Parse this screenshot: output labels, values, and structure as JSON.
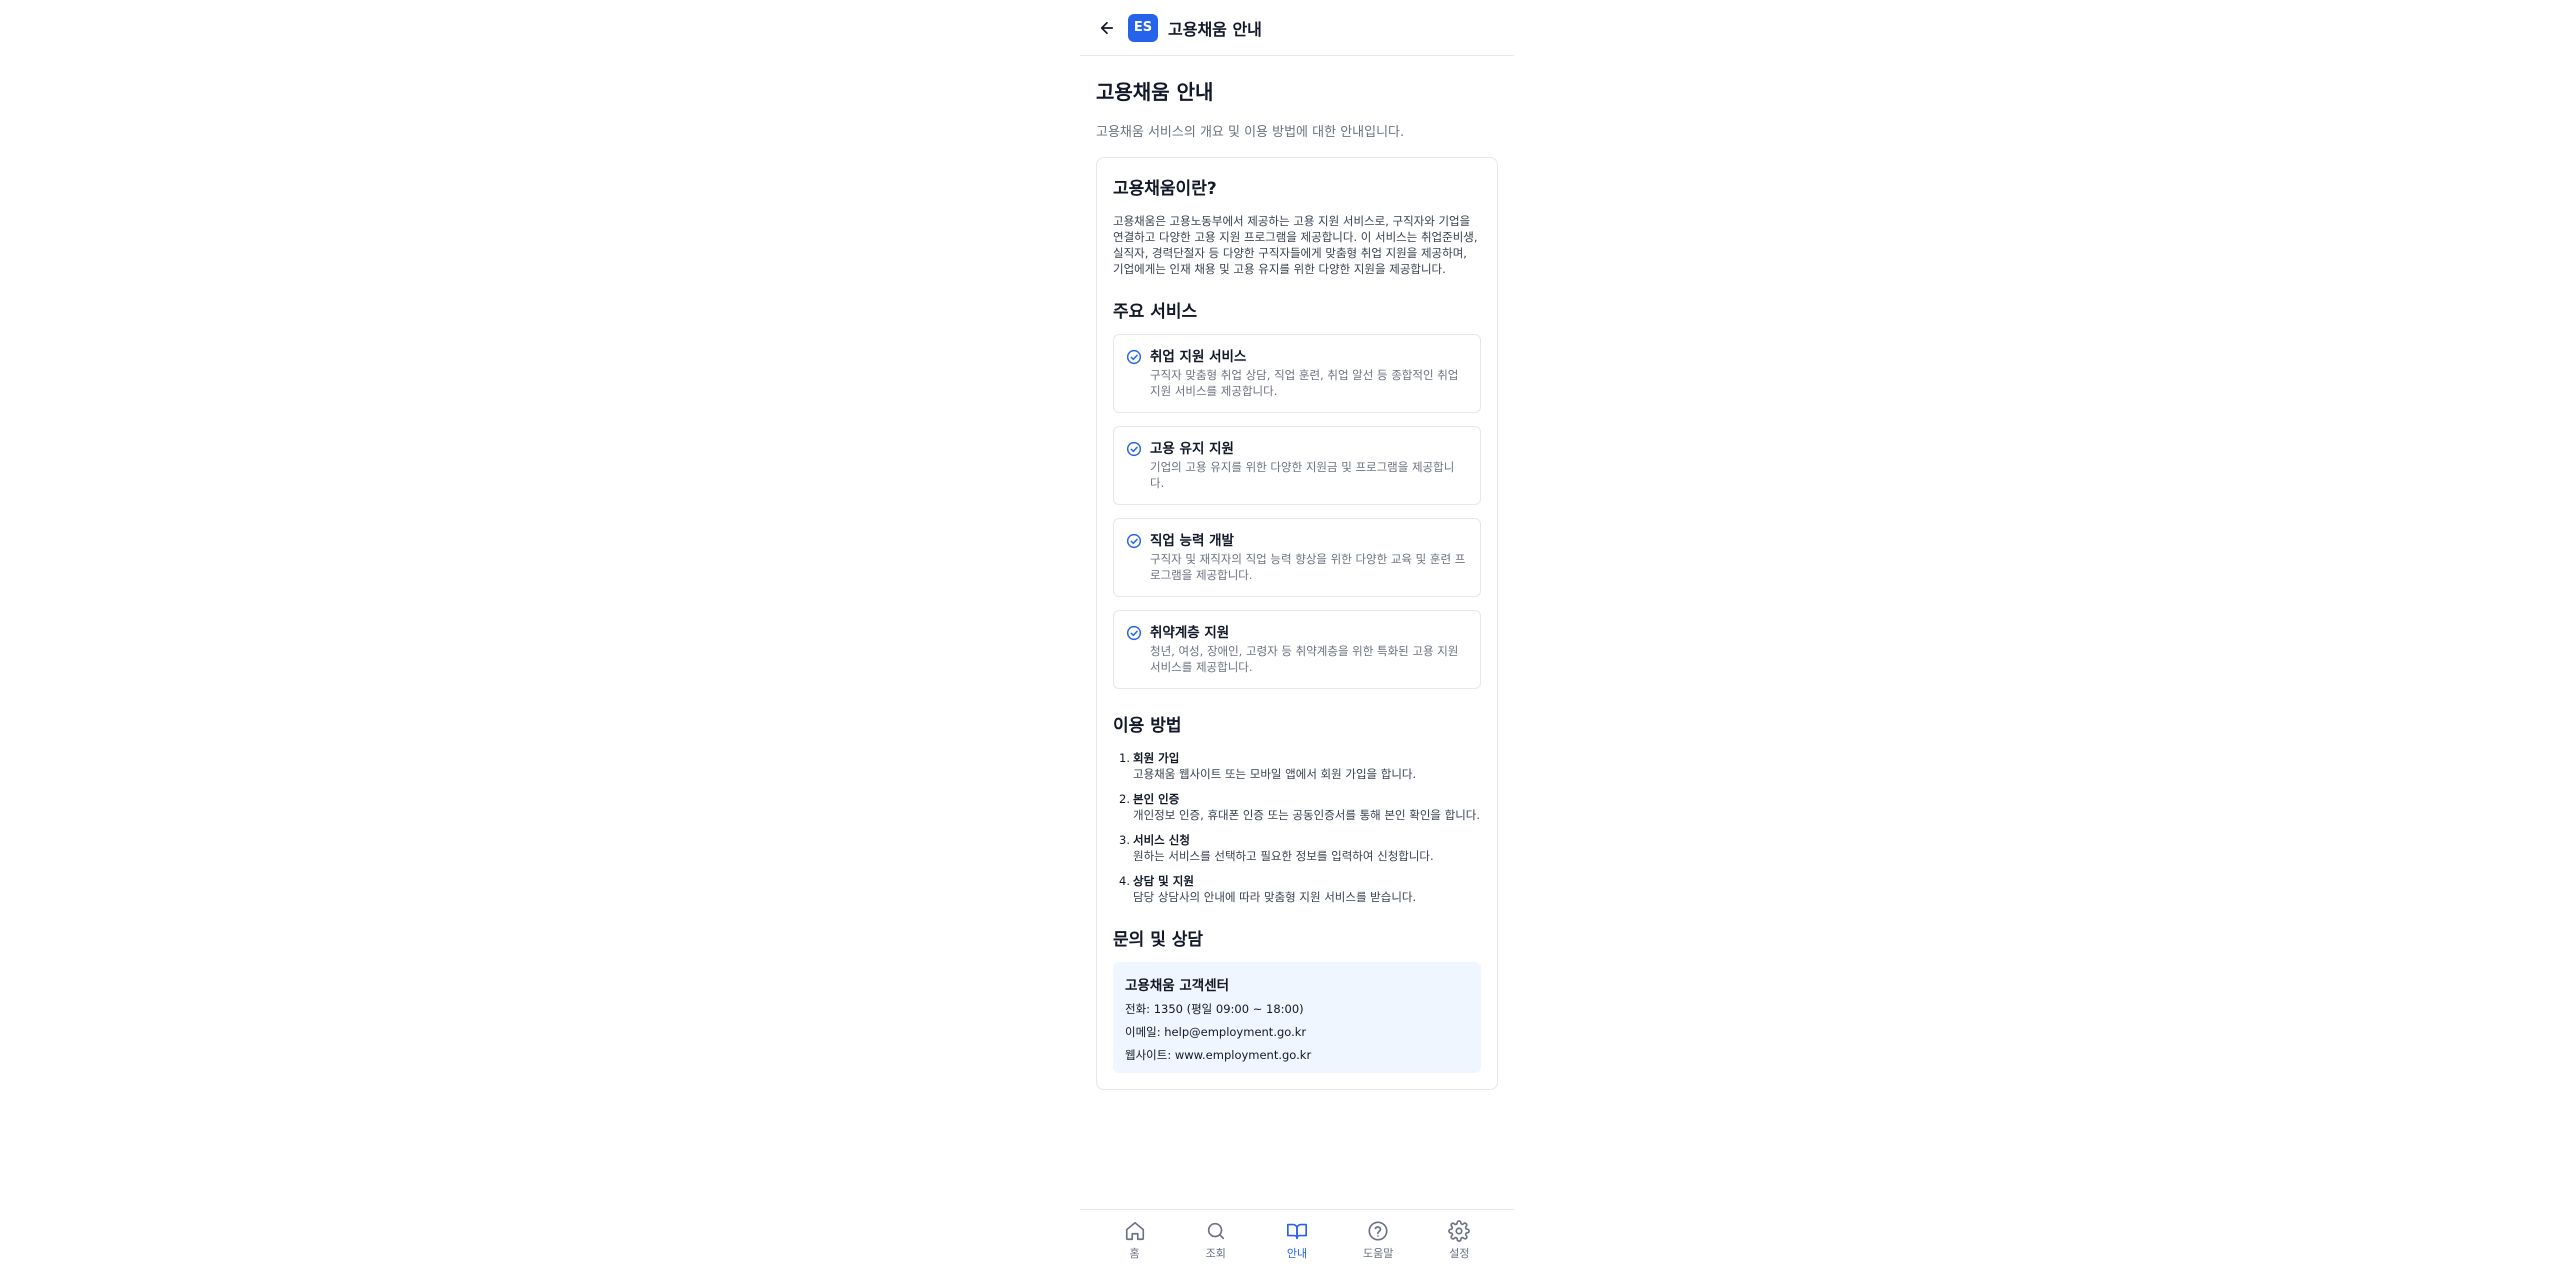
{
  "header": {
    "logo_text": "ES",
    "title": "고용채움 안내"
  },
  "page": {
    "title": "고용채움 안내",
    "subtitle": "고용채움 서비스의 개요 및 이용 방법에 대한 안내입니다."
  },
  "intro": {
    "title": "고용채움이란?",
    "text": "고용채움은 고용노동부에서 제공하는 고용 지원 서비스로, 구직자와 기업을 연결하고 다양한 고용 지원 프로그램을 제공합니다. 이 서비스는 취업준비생, 실직자, 경력단절자 등 다양한 구직자들에게 맞춤형 취업 지원을 제공하며, 기업에게는 인재 채용 및 고용 유지를 위한 다양한 지원을 제공합니다."
  },
  "services": {
    "title": "주요 서비스",
    "items": [
      {
        "name": "취업 지원 서비스",
        "desc": "구직자 맞춤형 취업 상담, 직업 훈련, 취업 알선 등 종합적인 취업 지원 서비스를 제공합니다."
      },
      {
        "name": "고용 유지 지원",
        "desc": "기업의 고용 유지를 위한 다양한 지원금 및 프로그램을 제공합니다."
      },
      {
        "name": "직업 능력 개발",
        "desc": "구직자 및 재직자의 직업 능력 향상을 위한 다양한 교육 및 훈련 프로그램을 제공합니다."
      },
      {
        "name": "취약계층 지원",
        "desc": "청년, 여성, 장애인, 고령자 등 취약계층을 위한 특화된 고용 지원 서비스를 제공합니다."
      }
    ]
  },
  "usage": {
    "title": "이용 방법",
    "steps": [
      {
        "num": "1.",
        "name": "회원 가입",
        "desc": "고용채움 웹사이트 또는 모바일 앱에서 회원 가입을 합니다."
      },
      {
        "num": "2.",
        "name": "본인 인증",
        "desc": "개인정보 인증, 휴대폰 인증 또는 공동인증서를 통해 본인 확인을 합니다."
      },
      {
        "num": "3.",
        "name": "서비스 신청",
        "desc": "원하는 서비스를 선택하고 필요한 정보를 입력하여 신청합니다."
      },
      {
        "num": "4.",
        "name": "상담 및 지원",
        "desc": "담당 상담사의 안내에 따라 맞춤형 지원 서비스를 받습니다."
      }
    ]
  },
  "contact": {
    "title": "문의 및 상담",
    "name": "고용채움 고객센터",
    "phone": "전화: 1350 (평일 09:00 ~ 18:00)",
    "email": "이메일: help@employment.go.kr",
    "website": "웹사이트: www.employment.go.kr"
  },
  "nav": {
    "items": [
      {
        "label": "홈",
        "icon": "home-icon"
      },
      {
        "label": "조회",
        "icon": "search-icon"
      },
      {
        "label": "안내",
        "icon": "book-icon"
      },
      {
        "label": "도움말",
        "icon": "help-icon"
      },
      {
        "label": "설정",
        "icon": "settings-icon"
      }
    ],
    "active_index": 2
  },
  "colors": {
    "accent": "#2563eb",
    "muted": "#6b7280",
    "contact_bg": "#eff6ff"
  }
}
